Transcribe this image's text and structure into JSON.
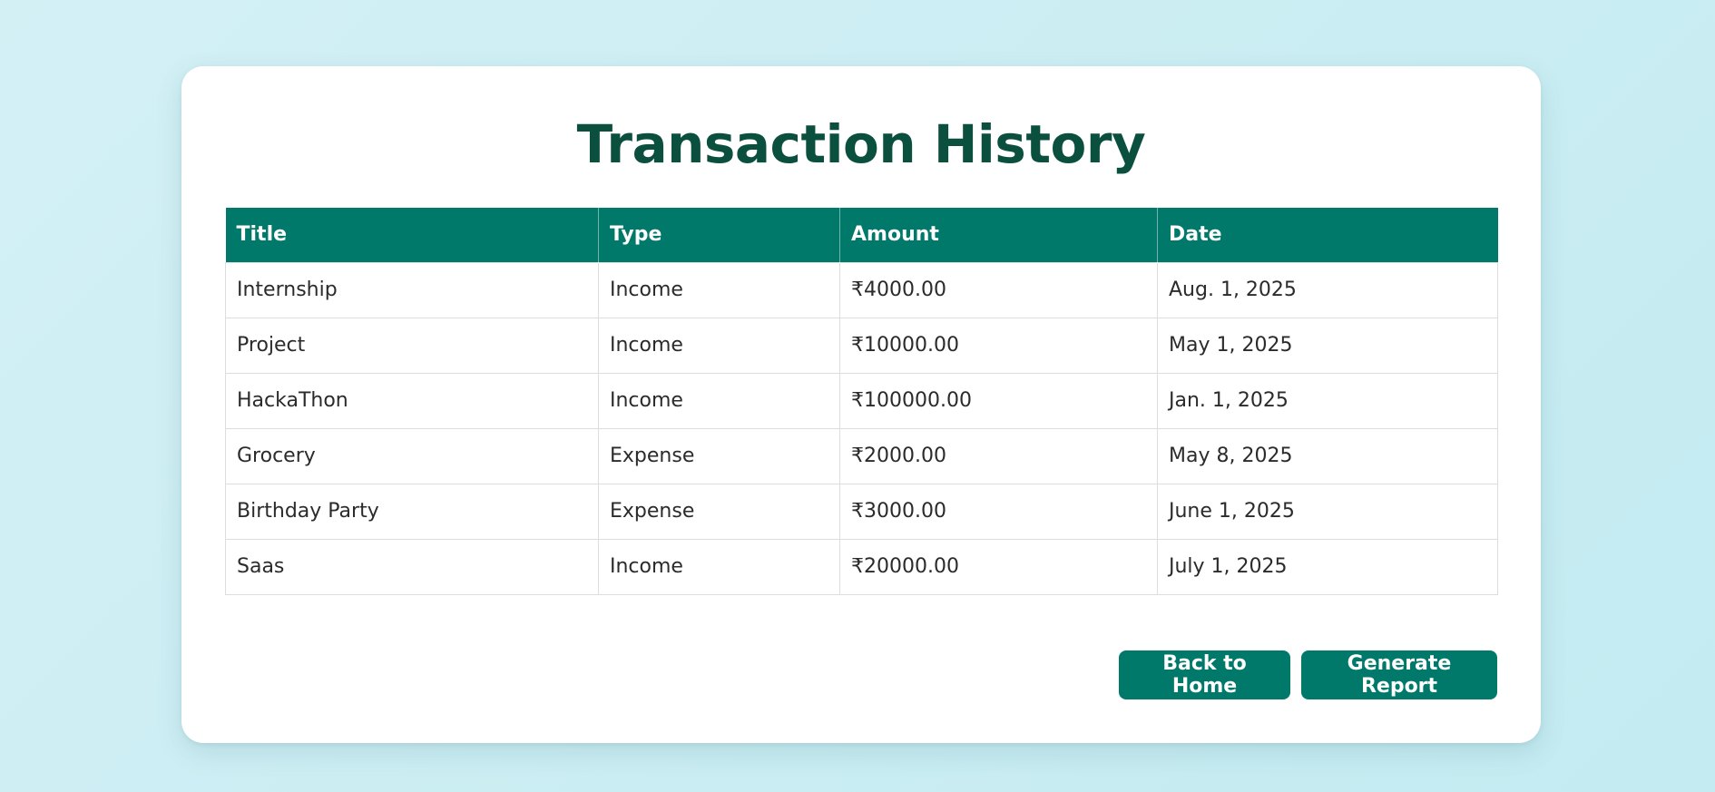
{
  "page": {
    "title": "Transaction History"
  },
  "table": {
    "headers": [
      "Title",
      "Type",
      "Amount",
      "Date"
    ],
    "rows": [
      [
        "Internship",
        "Income",
        "₹4000.00",
        "Aug. 1, 2025"
      ],
      [
        "Project",
        "Income",
        "₹10000.00",
        "May 1, 2025"
      ],
      [
        "HackaThon",
        "Income",
        "₹100000.00",
        "Jan. 1, 2025"
      ],
      [
        "Grocery",
        "Expense",
        "₹2000.00",
        "May 8, 2025"
      ],
      [
        "Birthday Party",
        "Expense",
        "₹3000.00",
        "June 1, 2025"
      ],
      [
        "Saas",
        "Income",
        "₹20000.00",
        "July 1, 2025"
      ]
    ]
  },
  "actions": {
    "back_label": "Back to Home",
    "report_label": "Generate Report"
  },
  "colors": {
    "accent": "#00796b",
    "title": "#0b4f3f",
    "background": "#cdeef4"
  }
}
